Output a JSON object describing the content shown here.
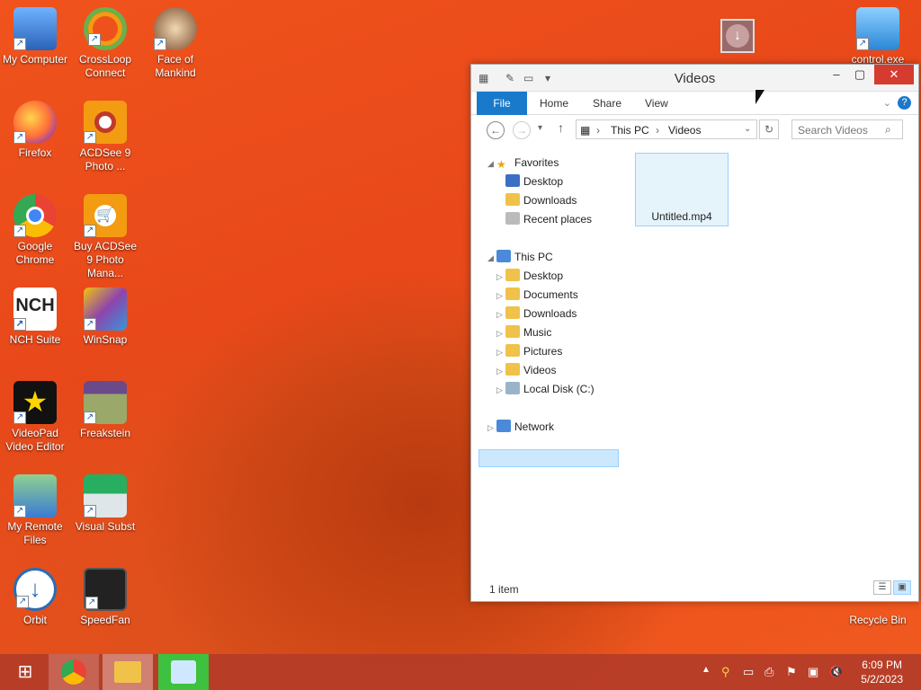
{
  "desktop": {
    "icons_left": [
      {
        "label": "My Computer",
        "icon": "computer-icon",
        "color": "#3a7bd5"
      },
      {
        "label": "Firefox",
        "icon": "firefox-icon",
        "color": "#ff7139"
      },
      {
        "label": "Google Chrome",
        "icon": "chrome-icon",
        "color": "#4285f4"
      },
      {
        "label": "NCH Suite",
        "icon": "nch-icon",
        "color": "#222222"
      },
      {
        "label": "VideoPad Video Editor",
        "icon": "videopad-icon",
        "color": "#111111"
      },
      {
        "label": "My Remote Files",
        "icon": "remote-files-icon",
        "color": "#4a90d9"
      },
      {
        "label": "Orbit",
        "icon": "orbit-icon",
        "color": "#2a6db5"
      }
    ],
    "icons_mid": [
      {
        "label": "CrossLoop Connect",
        "icon": "crossloop-icon",
        "color": "#6ab04c"
      },
      {
        "label": "ACDSee 9 Photo ...",
        "icon": "acdsee-icon",
        "color": "#f39c12"
      },
      {
        "label": "Buy ACDSee 9 Photo Mana...",
        "icon": "acdsee-cart-icon",
        "color": "#f39c12"
      },
      {
        "label": "WinSnap",
        "icon": "winsnap-icon",
        "color": "#8e44ad"
      },
      {
        "label": "Freakstein",
        "icon": "freakstein-icon",
        "color": "#7f8c4a"
      },
      {
        "label": "Visual Subst",
        "icon": "visual-subst-icon",
        "color": "#27ae60"
      },
      {
        "label": "SpeedFan",
        "icon": "speedfan-icon",
        "color": "#333333"
      }
    ],
    "icon_face": {
      "label": "Face of Mankind",
      "icon": "face-of-mankind-icon",
      "color": "#7a4a2a"
    },
    "icon_control": {
      "label": "control.exe",
      "icon": "control-panel-icon",
      "color": "#3498db"
    },
    "icon_recycle": {
      "label": "Recycle Bin",
      "icon": "recycle-bin-icon",
      "color": "#cccccc"
    },
    "icon_download_tile": {
      "icon": "download-arrow-icon",
      "color": "#9a6a6a"
    }
  },
  "window": {
    "title": "Videos",
    "ribbon_tabs": [
      "File",
      "Home",
      "Share",
      "View"
    ],
    "address": {
      "root": "This PC",
      "current": "Videos"
    },
    "search_placeholder": "Search Videos",
    "nav": {
      "favorites_label": "Favorites",
      "favorites": [
        "Desktop",
        "Downloads",
        "Recent places"
      ],
      "thispc_label": "This PC",
      "thispc": [
        "Desktop",
        "Documents",
        "Downloads",
        "Music",
        "Pictures",
        "Videos",
        "Local Disk (C:)"
      ],
      "network_label": "Network"
    },
    "files": [
      {
        "name": "Untitled.mp4"
      }
    ],
    "status": "1 item"
  },
  "taskbar": {
    "time": "6:09 PM",
    "date": "5/2/2023"
  },
  "colors": {
    "accent": "#1979ca",
    "selection": "#cce8ff",
    "close": "#d63b2f"
  }
}
